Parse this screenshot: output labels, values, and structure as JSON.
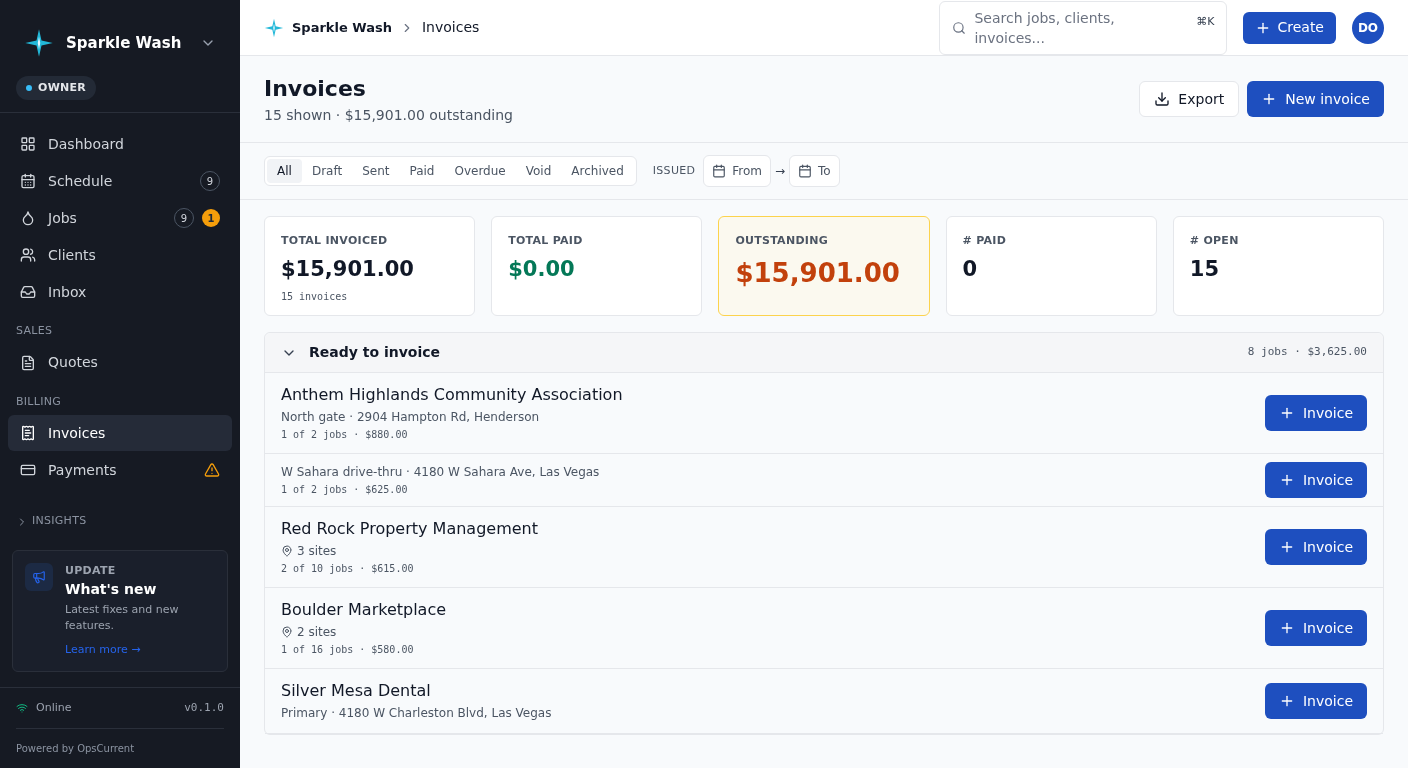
{
  "sidebar": {
    "brand": "Sparkle Wash",
    "role": "OWNER",
    "sections": [
      {
        "items": [
          {
            "label": "Dashboard",
            "selected": false
          },
          {
            "label": "Schedule",
            "selected": false,
            "count": "9"
          },
          {
            "label": "Jobs",
            "selected": false,
            "count": "9",
            "alert": "1"
          },
          {
            "label": "Clients",
            "selected": false
          },
          {
            "label": "Inbox",
            "selected": false
          }
        ]
      },
      {
        "heading": "SALES",
        "items": [
          {
            "label": "Quotes",
            "selected": false
          }
        ]
      },
      {
        "heading": "BILLING",
        "items": [
          {
            "label": "Invoices",
            "selected": true
          },
          {
            "label": "Payments",
            "selected": false,
            "warning": true
          }
        ]
      }
    ],
    "collapsed_section": {
      "label": "INSIGHTS",
      "expanded": false
    },
    "update_card": {
      "eyebrow": "UPDATE",
      "title": "What's new",
      "text": "Latest fixes and new features.",
      "link": "Learn more →"
    },
    "status": {
      "label": "Online",
      "version": "v0.1.0"
    },
    "footer": "Powered by OpsCurrent"
  },
  "topbar": {
    "breadcrumb": [
      "Sparkle Wash",
      "Invoices"
    ],
    "search_placeholder": "Search jobs, clients, invoices...",
    "shortcut": "⌘K",
    "create": "Create",
    "avatar": "DO"
  },
  "page": {
    "title": "Invoices",
    "subtitle": "15 shown · $15,901.00 outstanding",
    "actions": [
      {
        "label": "Export",
        "kind": "secondary"
      },
      {
        "label": "New invoice",
        "kind": "primary"
      }
    ]
  },
  "filters": {
    "tabs": [
      {
        "label": "All",
        "selected": true
      },
      {
        "label": "Draft",
        "selected": false
      },
      {
        "label": "Sent",
        "selected": false
      },
      {
        "label": "Paid",
        "selected": false
      },
      {
        "label": "Overdue",
        "selected": false
      },
      {
        "label": "Void",
        "selected": false
      },
      {
        "label": "Archived",
        "selected": false
      }
    ],
    "issued_label": "ISSUED",
    "from": "From",
    "arrow": "→",
    "to": "To"
  },
  "stats": [
    {
      "label": "TOTAL INVOICED",
      "value": "$15,901.00",
      "note": "15 invoices",
      "kind": "neutral",
      "highlight": false
    },
    {
      "label": "TOTAL PAID",
      "value": "$0.00",
      "kind": "positive",
      "highlight": false
    },
    {
      "label": "OUTSTANDING",
      "value": "$15,901.00",
      "kind": "warning",
      "highlight": true
    },
    {
      "label": "# PAID",
      "value": "0",
      "kind": "neutral",
      "highlight": false
    },
    {
      "label": "# OPEN",
      "value": "15",
      "kind": "neutral",
      "highlight": false
    }
  ],
  "ready": {
    "title": "Ready to invoice",
    "expanded": true,
    "summary": "8 jobs · $3,625.00",
    "rows": [
      {
        "kind": "address",
        "name": "Anthem Highlands Community Association",
        "detail": "North gate · 2904 Hampton Rd, Henderson",
        "meta": "1 of 2 jobs · $880.00",
        "button": "Invoice"
      },
      {
        "kind": "address",
        "detail": "W Sahara drive-thru · 4180 W Sahara Ave, Las Vegas",
        "meta": "1 of 2 jobs · $625.00",
        "button": "Invoice"
      },
      {
        "kind": "sites",
        "name": "Red Rock Property Management",
        "detail": "3 sites",
        "meta": "2 of 10 jobs · $615.00",
        "button": "Invoice"
      },
      {
        "kind": "sites",
        "name": "Boulder Marketplace",
        "detail": "2 sites",
        "meta": "1 of 16 jobs · $580.00",
        "button": "Invoice"
      },
      {
        "kind": "address",
        "name": "Silver Mesa Dental",
        "detail": "Primary · 4180 W Charleston Blvd, Las Vegas",
        "button": "Invoice"
      }
    ]
  }
}
